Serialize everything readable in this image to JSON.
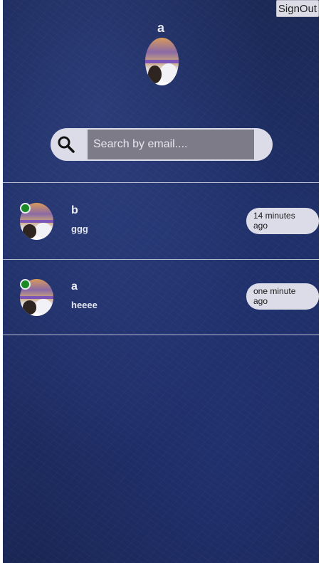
{
  "header": {
    "signout_label": "SignOut",
    "user_name": "a",
    "avatar_icon": "profile-avatar"
  },
  "search": {
    "placeholder": "Search by email....",
    "value": "",
    "icon": "search-icon"
  },
  "conversations": [
    {
      "name": "b",
      "last_message": "ggg",
      "time": "14 minutes ago",
      "online": true
    },
    {
      "name": "a",
      "last_message": "heeee",
      "time": "one minute ago",
      "online": true
    }
  ],
  "colors": {
    "background": "#1f2f66",
    "pill": "#dcdce8",
    "online": "#1a8a24",
    "search_input": "#7e7b89"
  }
}
